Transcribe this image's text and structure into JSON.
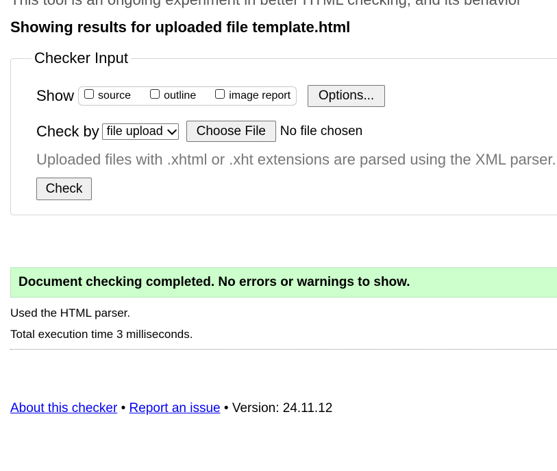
{
  "top_text": "This tool is an ongoing experiment in better HTML checking, and its behavior",
  "results_heading": "Showing results for uploaded file template.html",
  "checker_input": {
    "legend": "Checker Input",
    "show_label": "Show",
    "show_options": [
      "source",
      "outline",
      "image report"
    ],
    "options_button": "Options...",
    "check_by_label": "Check by",
    "check_by_value": "file upload",
    "choose_file_button": "Choose File",
    "file_status": "No file chosen",
    "note": "Uploaded files with .xhtml or .xht extensions are parsed using the XML parser.",
    "check_button": "Check"
  },
  "result": {
    "success_message": "Document checking completed. No errors or warnings to show.",
    "parser_info": "Used the HTML parser.",
    "execution_time": "Total execution time 3 milliseconds."
  },
  "footer": {
    "about_link": "About this checker",
    "separator": "•",
    "report_link": "Report an issue",
    "version": "Version: 24.11.12"
  },
  "colors": {
    "success_bg": "#ccffcc",
    "link": "#0000ee"
  }
}
